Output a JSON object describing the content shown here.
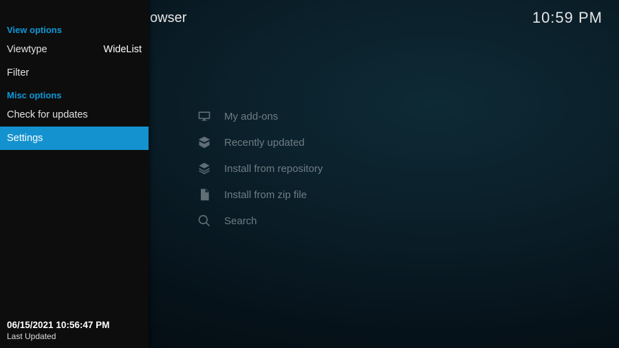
{
  "header": {
    "title_suffix": "owser",
    "clock": "10:59 PM"
  },
  "sidebar": {
    "section_view": "View options",
    "viewtype_label": "Viewtype",
    "viewtype_value": "WideList",
    "filter_label": "Filter",
    "section_misc": "Misc options",
    "check_updates": "Check for updates",
    "settings": "Settings",
    "footer_timestamp": "06/15/2021 10:56:47 PM",
    "footer_last_updated": "Last Updated"
  },
  "main": {
    "items": [
      {
        "label": "My add-ons"
      },
      {
        "label": "Recently updated"
      },
      {
        "label": "Install from repository"
      },
      {
        "label": "Install from zip file"
      },
      {
        "label": "Search"
      }
    ]
  }
}
